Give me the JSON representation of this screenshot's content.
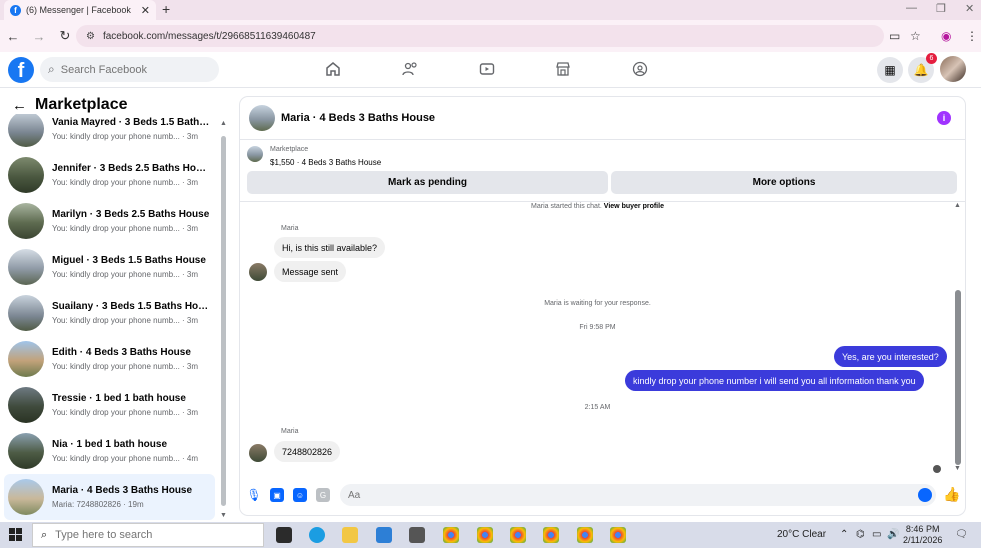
{
  "browser": {
    "tab_title": "(6) Messenger | Facebook",
    "fav_letter": "f",
    "new_tab": "+",
    "close_tab": "✕",
    "url": "facebook.com/messages/t/29668511639460487",
    "min": "—",
    "max": "❐",
    "close": "✕"
  },
  "fb": {
    "logo": "f",
    "search_placeholder": "Search Facebook",
    "notif_count": "6",
    "nav_icons": [
      "home-icon",
      "friends-icon",
      "video-icon",
      "marketplace-icon",
      "gaming-icon"
    ]
  },
  "left": {
    "title": "Marketplace",
    "conversations": [
      {
        "name": "Vania Mayred · 3 Beds 1.5 Baths ...",
        "preview": "You: kindly drop your phone numb... · 3m"
      },
      {
        "name": "Jennifer · 3 Beds 2.5 Baths House",
        "preview": "You: kindly drop your phone numb... · 3m"
      },
      {
        "name": "Marilyn · 3 Beds 2.5 Baths House",
        "preview": "You: kindly drop your phone numb... · 3m"
      },
      {
        "name": "Miguel · 3 Beds 1.5 Baths House",
        "preview": "You: kindly drop your phone numb... · 3m"
      },
      {
        "name": "Suailany · 3 Beds 1.5 Baths House",
        "preview": "You: kindly drop your phone numb... · 3m"
      },
      {
        "name": "Edith · 4 Beds 3 Baths House",
        "preview": "You: kindly drop your phone numb... · 3m"
      },
      {
        "name": "Tressie · 1 bed 1 bath house",
        "preview": "You: kindly drop your phone numb... · 3m"
      },
      {
        "name": "Nia · 1 bed 1 bath house",
        "preview": "You: kindly drop your phone numb... · 4m"
      },
      {
        "name": "Maria · 4 Beds 3 Baths House",
        "preview": "Maria: 7248802826 · 19m"
      }
    ]
  },
  "chat": {
    "title": "Maria · 4 Beds 3 Baths House",
    "info": "i",
    "listing_source": "Marketplace",
    "listing_price": "$1,550 · 4 Beds 3 Baths House",
    "mark_pending": "Mark as pending",
    "more_options": "More options",
    "started_text": "Maria started this chat.",
    "view_profile": "View buyer profile",
    "sender1": "Maria",
    "msg1": "Hi, is this still available?",
    "msg2": "Message sent",
    "waiting": "Maria is waiting for your response.",
    "time1": "Fri 9:58 PM",
    "out1": "Yes, are you interested?",
    "out2": "kindly drop your phone number i will send you all information thank you",
    "time2": "2:15 AM",
    "sender2": "Maria",
    "msg3": "7248802826",
    "composer_placeholder": "Aa"
  },
  "taskbar": {
    "search_placeholder": "Type here to search",
    "weather": "20°C  Clear",
    "time": "8:46 PM",
    "date": "2/11/2026",
    "notif": "1"
  }
}
